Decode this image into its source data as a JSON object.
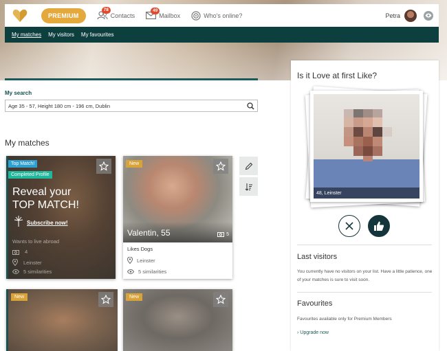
{
  "header": {
    "premium_label": "PREMIUM",
    "nav": [
      {
        "label": "Contacts",
        "badge": "78",
        "icon": "contacts-icon"
      },
      {
        "label": "Mailbox",
        "badge": "49",
        "icon": "mailbox-icon"
      },
      {
        "label": "Who's online?",
        "icon": "online-icon"
      }
    ],
    "user_name": "Petra"
  },
  "subnav": {
    "items": [
      "My matches",
      "My visitors",
      "My favourites"
    ],
    "active": "My matches"
  },
  "search": {
    "label": "My search",
    "value": "Age 35 - 57, Height 180 cm - 196 cm, Dublin"
  },
  "matches": {
    "title": "My matches",
    "top_card": {
      "tag_top": "Top Match!",
      "tag_complete": "Completed Profile",
      "reveal_line1": "Reveal your",
      "reveal_line2": "TOP MATCH!",
      "subscribe": "Subscribe now!",
      "wants": "Wants to live abroad",
      "photos": "4",
      "location": "Leinster",
      "similarities": "5 similarities"
    },
    "valentin": {
      "tag": "New",
      "name": "Valentin, 55",
      "photos": "5",
      "interest": "Likes Dogs",
      "location": "Leinster",
      "similarities": "5 similarities"
    },
    "bottom_tags": [
      "New",
      "New"
    ]
  },
  "right_panel": {
    "title": "Is it Love at first Like?",
    "photo_caption": "48, Leinster",
    "last_visitors_title": "Last visitors",
    "last_visitors_text": "You currently have no visitors on your list. Have a little patience, one of your matches is sure to visit soon.",
    "favourites_title": "Favourites",
    "favourites_text": "Favourites available only for Premium Members",
    "upgrade": "Upgrade now"
  },
  "colors": {
    "brand_dark": "#0d3f3f",
    "premium": "#e3a93d",
    "badge": "#e14a2d",
    "new_tag": "#d8a439",
    "top_match_tag": "#2f9fd0",
    "complete_tag": "#20b79c"
  }
}
